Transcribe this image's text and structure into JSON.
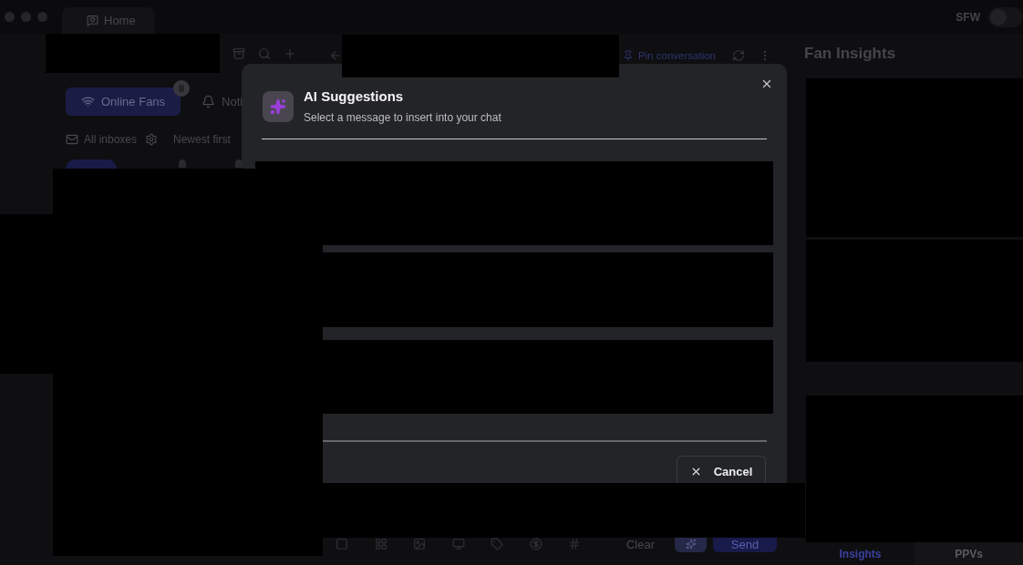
{
  "window": {
    "tab": {
      "label": "Home"
    },
    "sfw_toggle": {
      "label": "SFW",
      "on": false
    }
  },
  "sidebar": {
    "filters": [
      {
        "kind": "online",
        "label": "Online Fans",
        "selected": true
      },
      {
        "kind": "notifications",
        "label": "Noti",
        "selected": false
      }
    ],
    "inbox_filter": {
      "label": "All inboxes"
    },
    "sort": {
      "label": "Newest first"
    }
  },
  "chat": {
    "header": {
      "pin_label": "Pin conversation"
    },
    "composer": {
      "clear_label": "Clear",
      "send_label": "Send"
    }
  },
  "insights_panel": {
    "title": "Fan Insights",
    "tabs": [
      {
        "label": "Insights",
        "selected": true
      },
      {
        "label": "PPVs",
        "selected": false
      }
    ]
  },
  "modal": {
    "title": "AI Suggestions",
    "subtitle": "Select a message to insert into your chat",
    "cancel_label": "Cancel"
  }
}
